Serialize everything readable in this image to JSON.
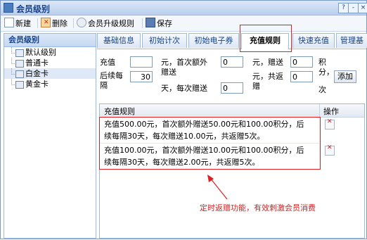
{
  "window": {
    "title": "会员级别",
    "help_label": "?",
    "min_label": "-",
    "close_label": "×"
  },
  "toolbar": {
    "new_label": "新建",
    "delete_label": "删除",
    "upgrade_label": "会员升级规则",
    "save_label": "保存"
  },
  "sidebar": {
    "header": "会员级别",
    "items": [
      {
        "label": "默认级别"
      },
      {
        "label": "普通卡"
      },
      {
        "label": "白金卡"
      },
      {
        "label": "黄金卡"
      }
    ]
  },
  "tabs": [
    {
      "label": "基础信息"
    },
    {
      "label": "初始计次"
    },
    {
      "label": "初始电子券"
    },
    {
      "label": "充值规则"
    },
    {
      "label": "快速充值"
    },
    {
      "label": "管理基"
    }
  ],
  "form": {
    "recharge_label": "充值",
    "recharge_value": "",
    "first_extra_label": "元，首次额外",
    "gift_label": "赠送",
    "first_extra_value": "0",
    "yuan_gift_label": "元，赠送",
    "points_value": "0",
    "points_label": "积",
    "points_label2": "分，",
    "times_label": "次",
    "every_label_a": "后续每",
    "every_label_b": "隔",
    "every_value": "30",
    "days_label": "天，每次赠送",
    "each_value": "0",
    "total_label_a": "元，共返",
    "total_label_b": "赠",
    "total_value": "0",
    "add_label": "添加"
  },
  "grid": {
    "col_rule": "充值规则",
    "col_action": "操作",
    "rows": [
      {
        "line1": "充值500.00元，首次额外赠送50.00元和100.00积分，后",
        "line2": "续每隔30天，每次赠送10.00元，共返赠5次。"
      },
      {
        "line1": "充值100.00元，首次额外赠送10.00元和100.00积分，后",
        "line2": "续每隔30天，每次赠送2.00元，共返赠5次。"
      }
    ]
  },
  "annotation": "定时返赠功能，有效刺激会员消费",
  "colors": {
    "highlight_red": "#e02020",
    "accent_blue": "#15428b"
  }
}
